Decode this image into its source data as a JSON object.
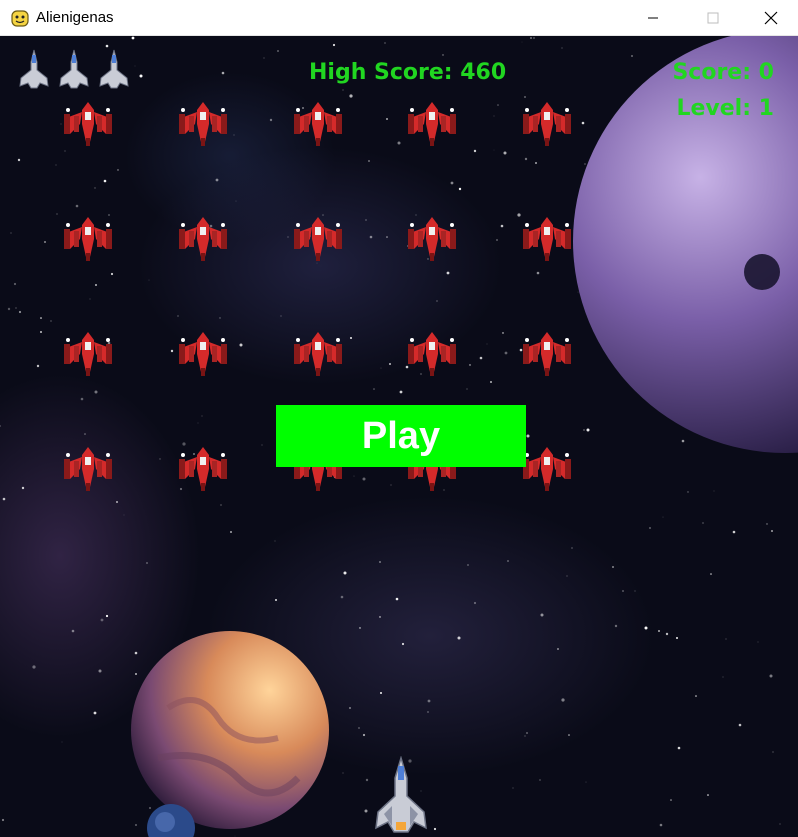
{
  "window": {
    "title": "Alienigenas",
    "icon": "pygame-snake-icon",
    "controls": [
      "minimize-icon",
      "maximize-icon",
      "close-icon"
    ]
  },
  "hud": {
    "high_score": "High Score: 460",
    "score": "Score: 0",
    "level": "Level: 1",
    "text_color": "#21d621"
  },
  "lives": {
    "count": 3,
    "icon": "ship-icon"
  },
  "aliens": {
    "rows": 4,
    "cols": 5,
    "icon": "alien-ship-icon",
    "color": "#d42a2a"
  },
  "play_button": {
    "label": "Play",
    "color": "#00ff00"
  },
  "player": {
    "icon": "player-ship-icon"
  },
  "background": {
    "planets": [
      "purple-planet",
      "orange-planet",
      "blue-planet"
    ]
  }
}
